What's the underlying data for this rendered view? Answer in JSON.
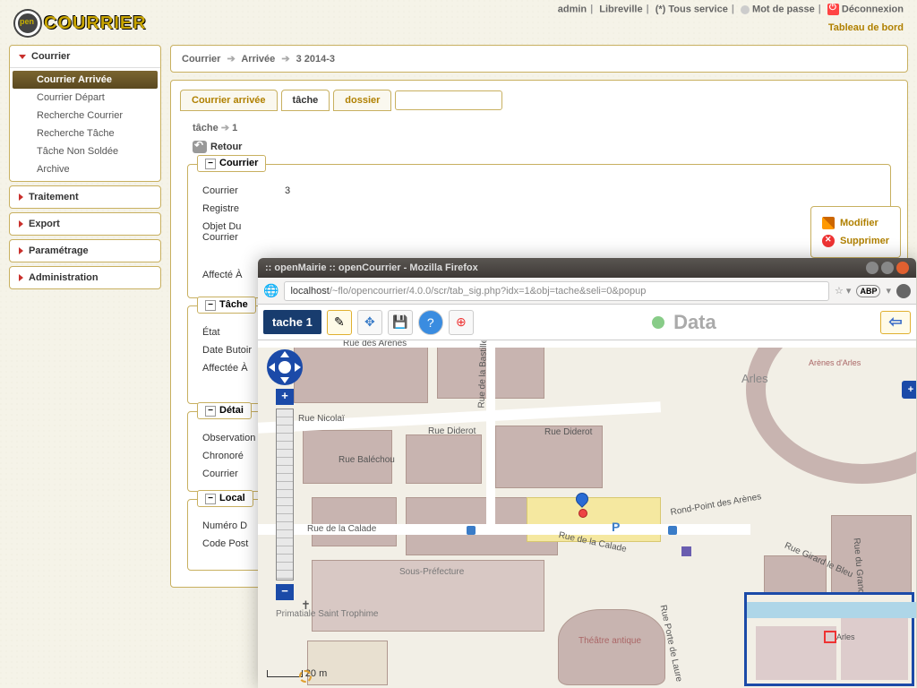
{
  "top": {
    "logo_open": "pen",
    "logo_rest": "COURRIER",
    "user": "admin",
    "loc": "Libreville",
    "svc": "(*) Tous service",
    "pwd": "Mot de passe",
    "logout": "Déconnexion",
    "dashboard": "Tableau de bord"
  },
  "sidebar": {
    "panels": [
      {
        "title": "Courrier",
        "open": true,
        "items": [
          "Courrier Arrivée",
          "Courrier Départ",
          "Recherche Courrier",
          "Recherche Tâche",
          "Tâche Non Soldée",
          "Archive"
        ],
        "active": 0
      },
      {
        "title": "Traitement"
      },
      {
        "title": "Export"
      },
      {
        "title": "Paramétrage"
      },
      {
        "title": "Administration"
      }
    ]
  },
  "breadcrumb": {
    "a": "Courrier",
    "b": "Arrivée",
    "c": "3  2014-3"
  },
  "tabs": {
    "t1": "Courrier arrivée",
    "t2": "tâche",
    "t3": "dossier"
  },
  "subcrumb": {
    "a": "tâche",
    "b": "1"
  },
  "retour": "Retour",
  "actions": {
    "mod": "Modifier",
    "sup": "Supprimer"
  },
  "fs1": {
    "title": "Courrier",
    "rows": {
      "courrier": {
        "l": "Courrier",
        "v": "3"
      },
      "registre": {
        "l": "Registre"
      },
      "objet": {
        "l": "Objet Du Courrier"
      },
      "affecte": {
        "l": "Affecté À"
      }
    }
  },
  "fs2": {
    "title": "Tâche",
    "rows": {
      "etat": {
        "l": "État"
      },
      "butoir": {
        "l": "Date Butoir"
      },
      "aff": {
        "l": "Affectée À"
      }
    }
  },
  "fs3": {
    "title": "Détai",
    "rows": {
      "obs": {
        "l": "Observation"
      },
      "chrono": {
        "l": "Chronoré"
      },
      "cour": {
        "l": "Courrier"
      }
    }
  },
  "fs4": {
    "title": "Local",
    "rows": {
      "num": {
        "l": "Numéro D"
      },
      "cp": {
        "l": "Code Post"
      }
    }
  },
  "popup": {
    "title": ":: openMairie :: openCourrier - Mozilla Firefox",
    "url_host": "localhost",
    "url_path": "/~flo/opencourrier/4.0.0/scr/tab_sig.php?idx=1&obj=tache&seli=0&popup",
    "badge": "tache 1",
    "data_label": "Data",
    "scale": "20 m",
    "abp": "ABP",
    "map_labels": {
      "rue_arenes": "Rue des Arènes",
      "rue_nicolai": "Rue Nicolaï",
      "rue_diderot": "Rue Diderot",
      "rue_diderot2": "Rue Diderot",
      "rue_balechou": "Rue Baléchou",
      "rue_bastille": "Rue de la Bastille",
      "rue_calade": "Rue de la Calade",
      "rue_calade2": "Rue de la Calade",
      "rond_arenes": "Rond-Point des Arènes",
      "rue_girard": "Rue Girard le Bleu",
      "rue_grand": "Rue du Grand Cou",
      "rue_laure": "Rue Porte de Laure",
      "arles": "Arles",
      "arenes": "Arènes d'Arles",
      "sous_pref": "Sous-Préfecture",
      "theatre": "Théâtre antique",
      "primatiale": "Primatiale Saint Trophime",
      "mm_arles": "Arles"
    }
  }
}
